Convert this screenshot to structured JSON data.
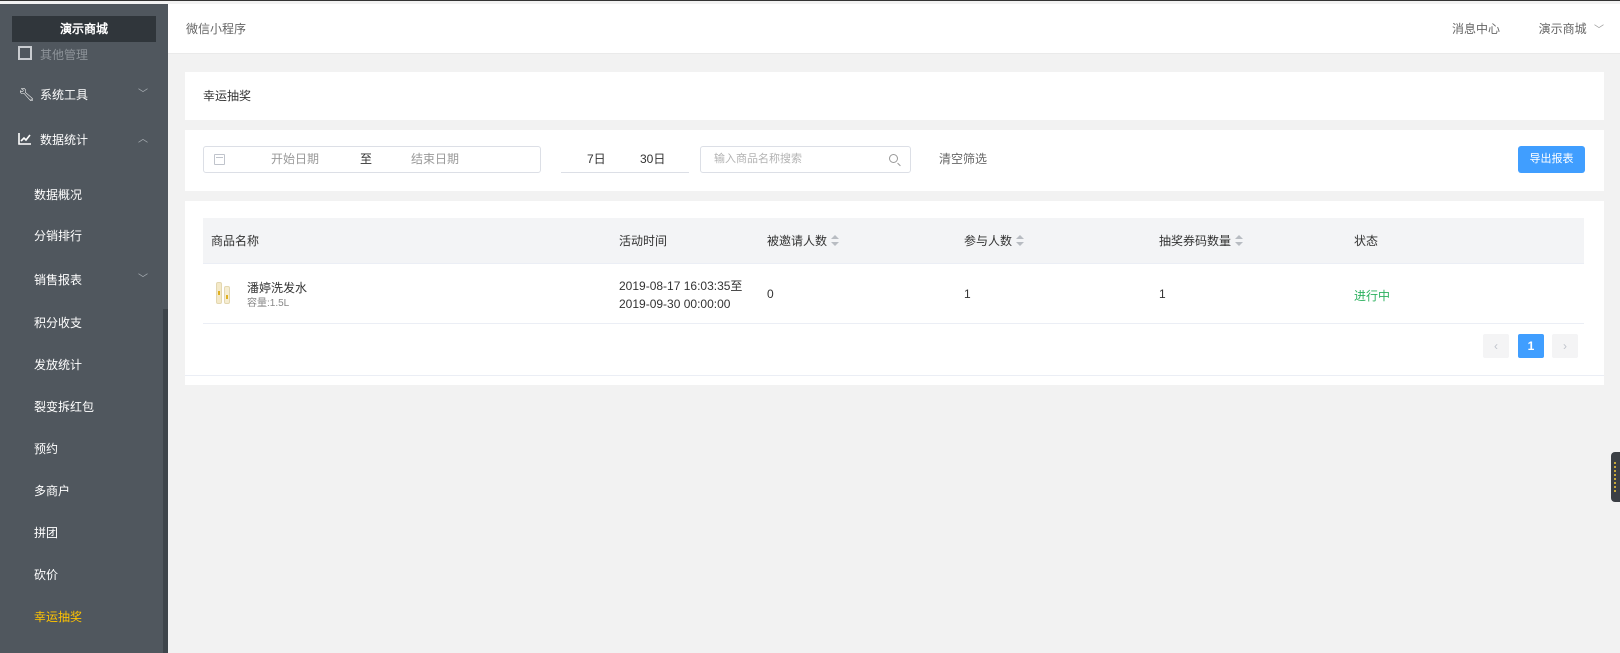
{
  "sidebar": {
    "brand": "演示商城",
    "ghost_label": "其他管理",
    "menu": [
      {
        "label": "系统工具",
        "icon": "wrench-icon"
      },
      {
        "label": "数据统计",
        "icon": "line-chart-icon"
      }
    ],
    "sub_items": [
      {
        "label": "数据概况"
      },
      {
        "label": "分销排行"
      },
      {
        "label": "销售报表"
      },
      {
        "label": "积分收支"
      },
      {
        "label": "发放统计"
      },
      {
        "label": "裂变拆红包"
      },
      {
        "label": "预约"
      },
      {
        "label": "多商户"
      },
      {
        "label": "拼团"
      },
      {
        "label": "砍价"
      },
      {
        "label": "幸运抽奖"
      }
    ],
    "active_color": "#ffc300",
    "bg_color": "#50575e"
  },
  "header": {
    "breadcrumb": "微信小程序",
    "message_center": "消息中心",
    "shop_name": "演示商城"
  },
  "page_title": "幸运抽奖",
  "filters": {
    "start_placeholder": "开始日期",
    "range_separator": "至",
    "end_placeholder": "结束日期",
    "quick_7": "7日",
    "quick_30": "30日",
    "search_placeholder": "输入商品名称搜索",
    "clear_label": "清空筛选",
    "export_label": "导出报表"
  },
  "table": {
    "headers": [
      "商品名称",
      "活动时间",
      "被邀请人数",
      "参与人数",
      "抽奖券码数量",
      "状态"
    ],
    "rows": [
      {
        "name": "潘婷洗发水",
        "spec": "容量:1.5L",
        "time_start": "2019-08-17 16:03:35至",
        "time_end": "2019-09-30 00:00:00",
        "invited": "0",
        "participants": "1",
        "tickets": "1",
        "status": "进行中"
      }
    ]
  },
  "pagination": {
    "prev": "‹",
    "current": "1",
    "next": "›"
  }
}
